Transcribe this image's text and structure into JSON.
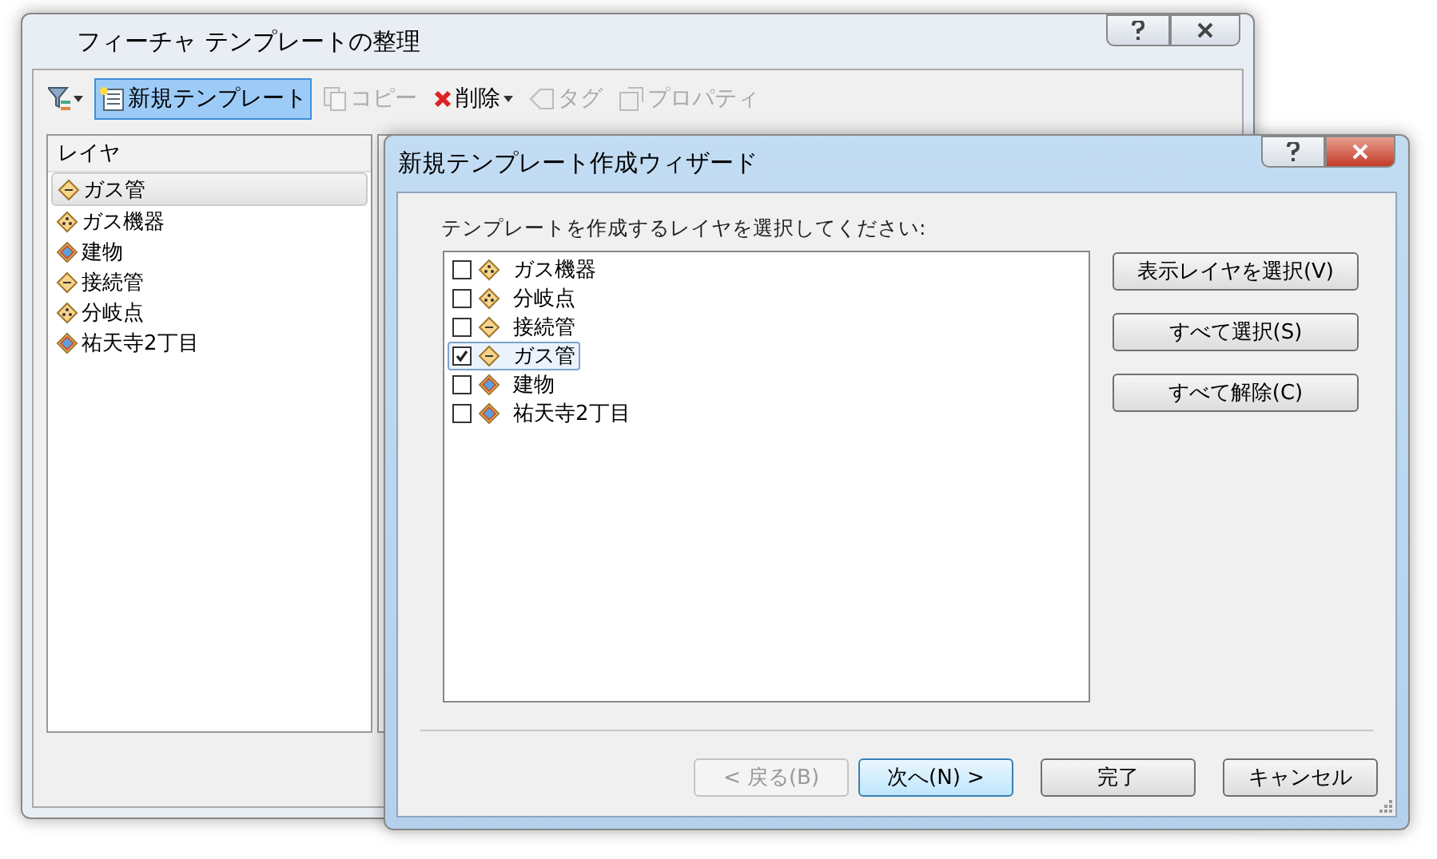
{
  "main_window": {
    "title": "フィーチャ テンプレートの整理",
    "toolbar": [
      {
        "kind": "filter",
        "disabled": false,
        "dropdown": true,
        "selected": false
      },
      {
        "kind": "new",
        "label": "新規テンプレート",
        "disabled": false,
        "dropdown": false,
        "selected": true
      },
      {
        "kind": "copy",
        "label": "コピー",
        "disabled": true,
        "dropdown": false,
        "selected": false
      },
      {
        "kind": "delete",
        "label": "削除",
        "disabled": false,
        "dropdown": true,
        "selected": false
      },
      {
        "kind": "tag",
        "label": "タグ",
        "disabled": true,
        "dropdown": false,
        "selected": false
      },
      {
        "kind": "properties",
        "label": "プロパティ",
        "disabled": true,
        "dropdown": false,
        "selected": false
      }
    ],
    "layer_list": {
      "header": "レイヤ",
      "items": [
        {
          "label": "ガス管",
          "kind": "line",
          "selected": true
        },
        {
          "label": "ガス機器",
          "kind": "point",
          "selected": false
        },
        {
          "label": "建物",
          "kind": "polygon",
          "selected": false
        },
        {
          "label": "接続管",
          "kind": "line",
          "selected": false
        },
        {
          "label": "分岐点",
          "kind": "point",
          "selected": false
        },
        {
          "label": "祐天寺2丁目",
          "kind": "polygon",
          "selected": false
        }
      ]
    }
  },
  "dialog": {
    "title": "新規テンプレート作成ウィザード",
    "prompt": "テンプレートを作成するレイヤを選択してください:",
    "layers": [
      {
        "label": "ガス機器",
        "kind": "point",
        "checked": false,
        "selected": false
      },
      {
        "label": "分岐点",
        "kind": "point",
        "checked": false,
        "selected": false
      },
      {
        "label": "接続管",
        "kind": "line",
        "checked": false,
        "selected": false
      },
      {
        "label": "ガス管",
        "kind": "line",
        "checked": true,
        "selected": true
      },
      {
        "label": "建物",
        "kind": "polygon",
        "checked": false,
        "selected": false
      },
      {
        "label": "祐天寺2丁目",
        "kind": "polygon",
        "checked": false,
        "selected": false
      }
    ],
    "side_buttons": [
      "表示レイヤを選択(V)",
      "すべて選択(S)",
      "すべて解除(C)"
    ],
    "footer_buttons": [
      {
        "label": "< 戻る(B)",
        "disabled": true,
        "default": false
      },
      {
        "label": "次へ(N) >",
        "disabled": false,
        "default": true
      },
      {
        "label": "完了",
        "disabled": false,
        "default": false
      },
      {
        "label": "キャンセル",
        "disabled": false,
        "default": false
      }
    ]
  }
}
